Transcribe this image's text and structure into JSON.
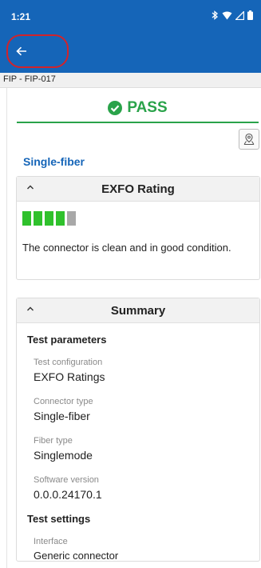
{
  "status_bar": {
    "time": "1:21"
  },
  "header": {
    "subtitle": "FIP - FIP-017"
  },
  "result": {
    "label": "PASS"
  },
  "section": {
    "title": "Single-fiber"
  },
  "rating_panel": {
    "title": "EXFO Rating",
    "score": 4,
    "max_score": 5,
    "description": "The connector is clean and in good condition."
  },
  "summary_panel": {
    "title": "Summary",
    "test_parameters": {
      "heading": "Test parameters",
      "fields": [
        {
          "label": "Test configuration",
          "value": "EXFO Ratings"
        },
        {
          "label": "Connector type",
          "value": "Single-fiber"
        },
        {
          "label": "Fiber type",
          "value": "Singlemode"
        },
        {
          "label": "Software version",
          "value": "0.0.0.24170.1"
        }
      ]
    },
    "test_settings": {
      "heading": "Test settings",
      "fields": [
        {
          "label": "Interface",
          "value": "Generic connector"
        }
      ]
    }
  },
  "colors": {
    "app_bar": "#1565b8",
    "pass_green": "#2aa34a",
    "rating_on": "#2fc12c",
    "rating_off": "#a8a8a8",
    "highlight": "#d2232a"
  },
  "icons": [
    "bluetooth-icon",
    "wifi-icon",
    "signal-icon",
    "battery-icon",
    "back-arrow-icon",
    "check-circle-icon",
    "map-pin-icon",
    "chevron-up-icon"
  ]
}
